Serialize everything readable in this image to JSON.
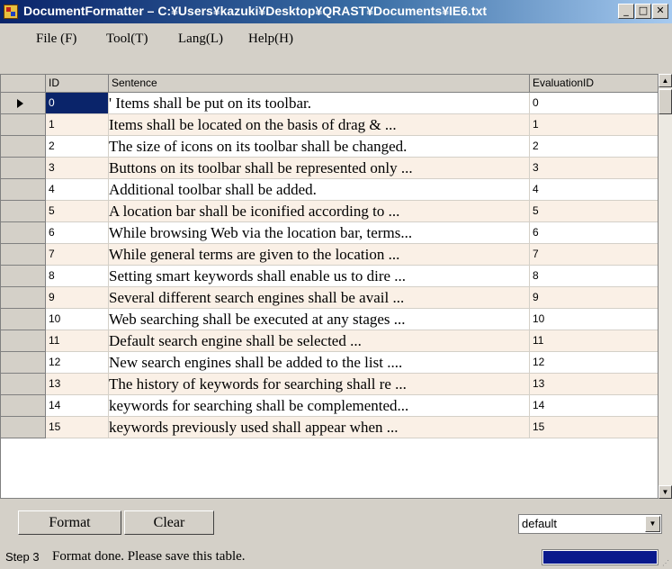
{
  "window": {
    "title": "DocumentFormatter  –  C:¥Users¥kazuki¥Desktop¥QRAST¥Documents¥IE6.txt",
    "minimize": "_",
    "maximize": "□",
    "close": "✕"
  },
  "menu": [
    {
      "label": "File (F)"
    },
    {
      "label": "Tool(T)"
    },
    {
      "label": "Lang(L)"
    },
    {
      "label": "Help(H)"
    }
  ],
  "grid": {
    "columns": {
      "id": "ID",
      "sentence": "Sentence",
      "evaluation": "EvaluationID"
    },
    "rows": [
      {
        "id": "0",
        "sentence": "' Items shall be put on its toolbar.",
        "evaluation": "0"
      },
      {
        "id": "1",
        "sentence": "Items shall be located on the basis of drag & ...",
        "evaluation": "1"
      },
      {
        "id": "2",
        "sentence": "The size of icons on its toolbar shall be changed.",
        "evaluation": "2"
      },
      {
        "id": "3",
        "sentence": "Buttons on its toolbar shall be represented only ...",
        "evaluation": "3"
      },
      {
        "id": "4",
        "sentence": " Additional toolbar shall be added.",
        "evaluation": "4"
      },
      {
        "id": "5",
        "sentence": " A location bar shall be iconified according to ...",
        "evaluation": "5"
      },
      {
        "id": "6",
        "sentence": "  While browsing Web via the location bar, terms...",
        "evaluation": "6"
      },
      {
        "id": "7",
        "sentence": "  While general terms are given to the location ...",
        "evaluation": "7"
      },
      {
        "id": "8",
        "sentence": "   Setting smart keywords shall enable us to dire ...",
        "evaluation": "8"
      },
      {
        "id": "9",
        "sentence": "   Several different search engines shall be avail ...",
        "evaluation": "9"
      },
      {
        "id": "10",
        "sentence": "  Web searching shall be executed at any stages ...",
        "evaluation": "10"
      },
      {
        "id": "11",
        "sentence": "Default search engine shall be selected ...",
        "evaluation": "11"
      },
      {
        "id": "12",
        "sentence": "  New search engines shall be added to the list ....",
        "evaluation": "12"
      },
      {
        "id": "13",
        "sentence": "The history of keywords for searching shall re ...",
        "evaluation": "13"
      },
      {
        "id": "14",
        "sentence": "  keywords for searching shall be complemented...",
        "evaluation": "14"
      },
      {
        "id": "15",
        "sentence": "   keywords previously used shall appear when ...",
        "evaluation": "15"
      }
    ],
    "selected_row": "0"
  },
  "buttons": {
    "format": "Format",
    "clear": "Clear"
  },
  "combo": {
    "value": "default"
  },
  "status": {
    "step": "Step 3",
    "message": "Format done. Please save this table.",
    "progress": 1.0
  },
  "colors": {
    "title_start": "#0a246a",
    "title_end": "#a6caf0",
    "row_alt": "#faf0e6",
    "selection": "#0a246a",
    "progress": "#0a1a8c"
  }
}
